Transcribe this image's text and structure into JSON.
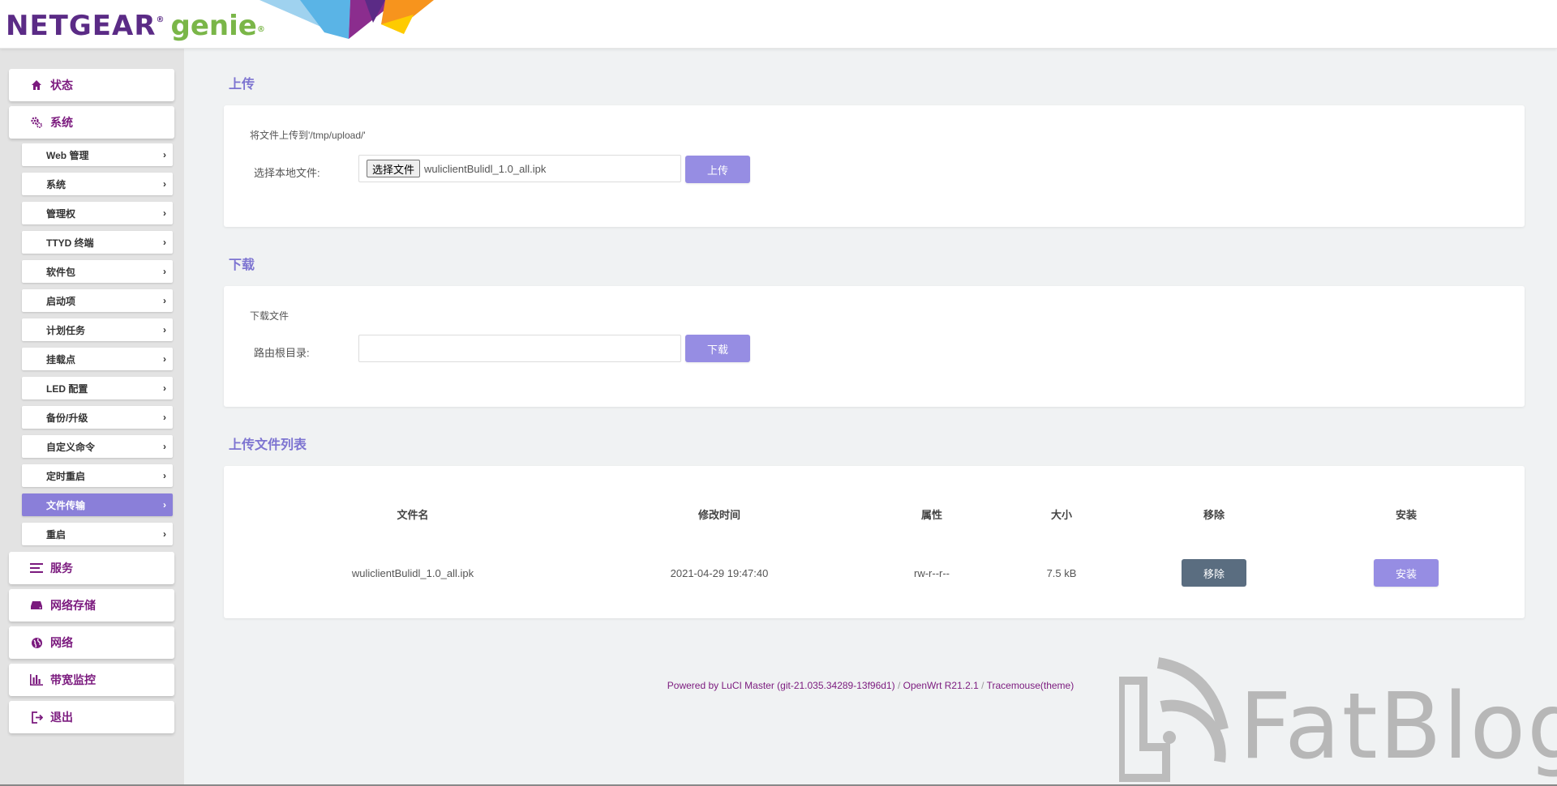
{
  "header": {
    "logo_netgear": "NETGEAR",
    "logo_genie": "genie",
    "registered_mark": "®"
  },
  "sidebar": {
    "main_top": [
      {
        "label": "状态",
        "icon": "home-icon"
      },
      {
        "label": "系统",
        "icon": "gears-icon"
      }
    ],
    "sub_items": [
      {
        "label": "Web 管理"
      },
      {
        "label": "系统"
      },
      {
        "label": "管理权"
      },
      {
        "label": "TTYD 终端"
      },
      {
        "label": "软件包"
      },
      {
        "label": "启动项"
      },
      {
        "label": "计划任务"
      },
      {
        "label": "挂载点"
      },
      {
        "label": "LED 配置"
      },
      {
        "label": "备份/升级"
      },
      {
        "label": "自定义命令"
      },
      {
        "label": "定时重启"
      },
      {
        "label": "文件传输",
        "active": true
      },
      {
        "label": "重启"
      }
    ],
    "main_bottom": [
      {
        "label": "服务",
        "icon": "list-icon"
      },
      {
        "label": "网络存储",
        "icon": "storage-icon"
      },
      {
        "label": "网络",
        "icon": "globe-icon"
      },
      {
        "label": "带宽监控",
        "icon": "bar-chart-icon"
      },
      {
        "label": "退出",
        "icon": "logout-icon"
      }
    ],
    "chevron": "›"
  },
  "upload": {
    "title": "上传",
    "description": "将文件上传到'/tmp/upload/'",
    "field_label": "选择本地文件:",
    "choose_button": "选择文件",
    "chosen_file": "wuliclientBulidl_1.0_all.ipk",
    "submit_label": "上传"
  },
  "download": {
    "title": "下载",
    "description": "下载文件",
    "field_label": "路由根目录:",
    "input_value": "",
    "submit_label": "下载"
  },
  "file_list": {
    "title": "上传文件列表",
    "columns": [
      "文件名",
      "修改时间",
      "属性",
      "大小",
      "移除",
      "安装"
    ],
    "rows": [
      {
        "name": "wuliclientBulidl_1.0_all.ipk",
        "modified": "2021-04-29 19:47:40",
        "attributes": "rw-r--r--",
        "size": "7.5 kB",
        "remove_label": "移除",
        "install_label": "安装"
      }
    ]
  },
  "footer": {
    "luci": "Powered by LuCI Master (git-21.035.34289-13f96d1)",
    "sep": "/",
    "openwrt": "OpenWrt R21.2.1",
    "theme": "Tracemouse(theme)"
  },
  "watermark": {
    "text": "FatBlog"
  },
  "colors": {
    "accent": "#968de3",
    "sidebar_active": "#8a7fd9",
    "nav_text": "#7b1a7e",
    "section_title": "#7d74d1",
    "remove_button": "#5a6d80"
  }
}
